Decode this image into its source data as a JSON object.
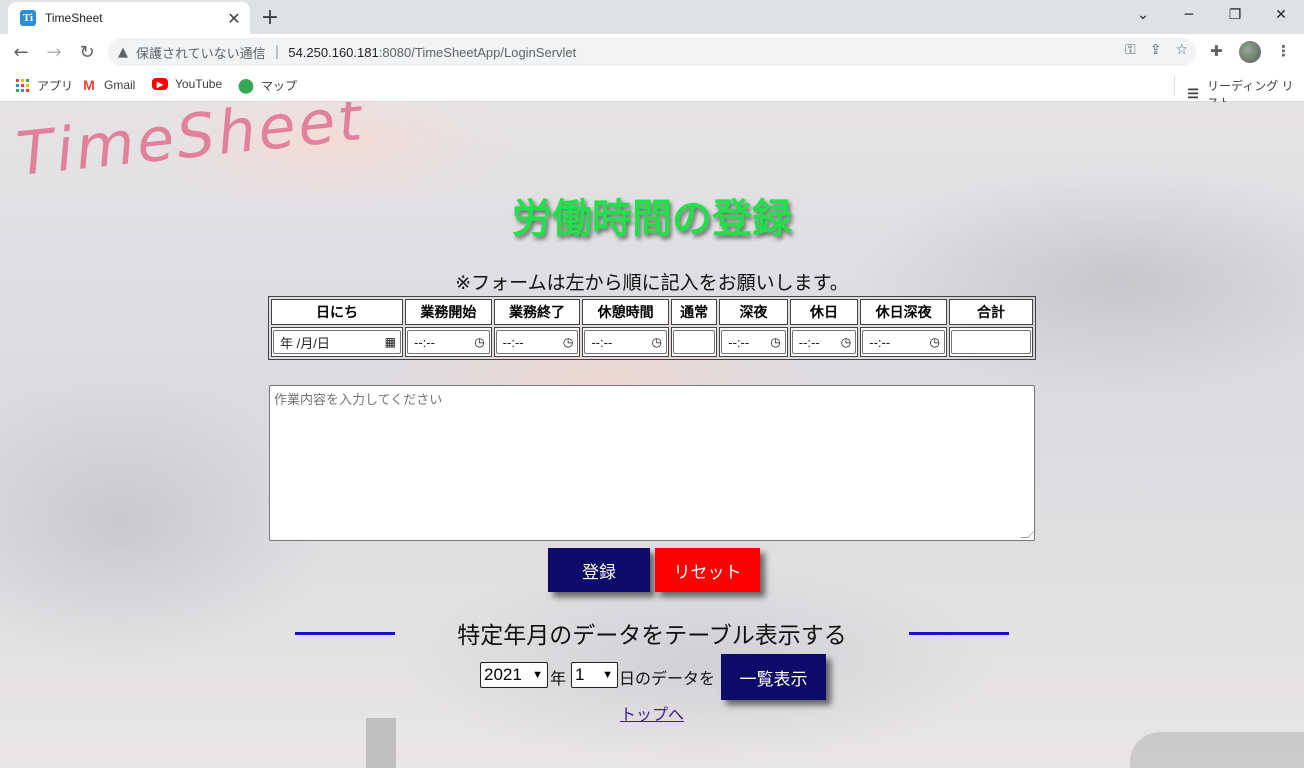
{
  "browser": {
    "tab_title": "TimeSheet",
    "favicon_letter": "Ti",
    "security_label": "保護されていない通信",
    "url_host": "54.250.160.181",
    "url_rest": ":8080/TimeSheetApp/LoginServlet",
    "bookmarks": [
      "アプリ",
      "Gmail",
      "YouTube",
      "マップ"
    ],
    "reading_list": "リーディング リスト"
  },
  "page": {
    "logo": "TimeSheet",
    "heading": "労働時間の登録",
    "notice": "※フォームは左から順に記入をお願いします。",
    "table": {
      "headers": [
        "日にち",
        "業務開始",
        "業務終了",
        "休憩時間",
        "通常",
        "深夜",
        "休日",
        "休日深夜",
        "合計"
      ],
      "date_placeholder": "年 /月/日",
      "time_placeholder": "--:--"
    },
    "textarea_placeholder": "作業内容を入力してください",
    "register_label": "登録",
    "reset_label": "リセット",
    "subheading": "特定年月のデータをテーブル表示する",
    "year_value": "2021",
    "year_suffix": "年",
    "month_value": "1",
    "month_suffix": "日のデータを",
    "list_button": "一覧表示",
    "top_link": "トップへ"
  },
  "colors": {
    "heading": "#22e04a",
    "logo": "#e2819c",
    "navy_button": "#0d0b6a",
    "reset_button": "#ff0000",
    "rule": "#1a10c8"
  }
}
